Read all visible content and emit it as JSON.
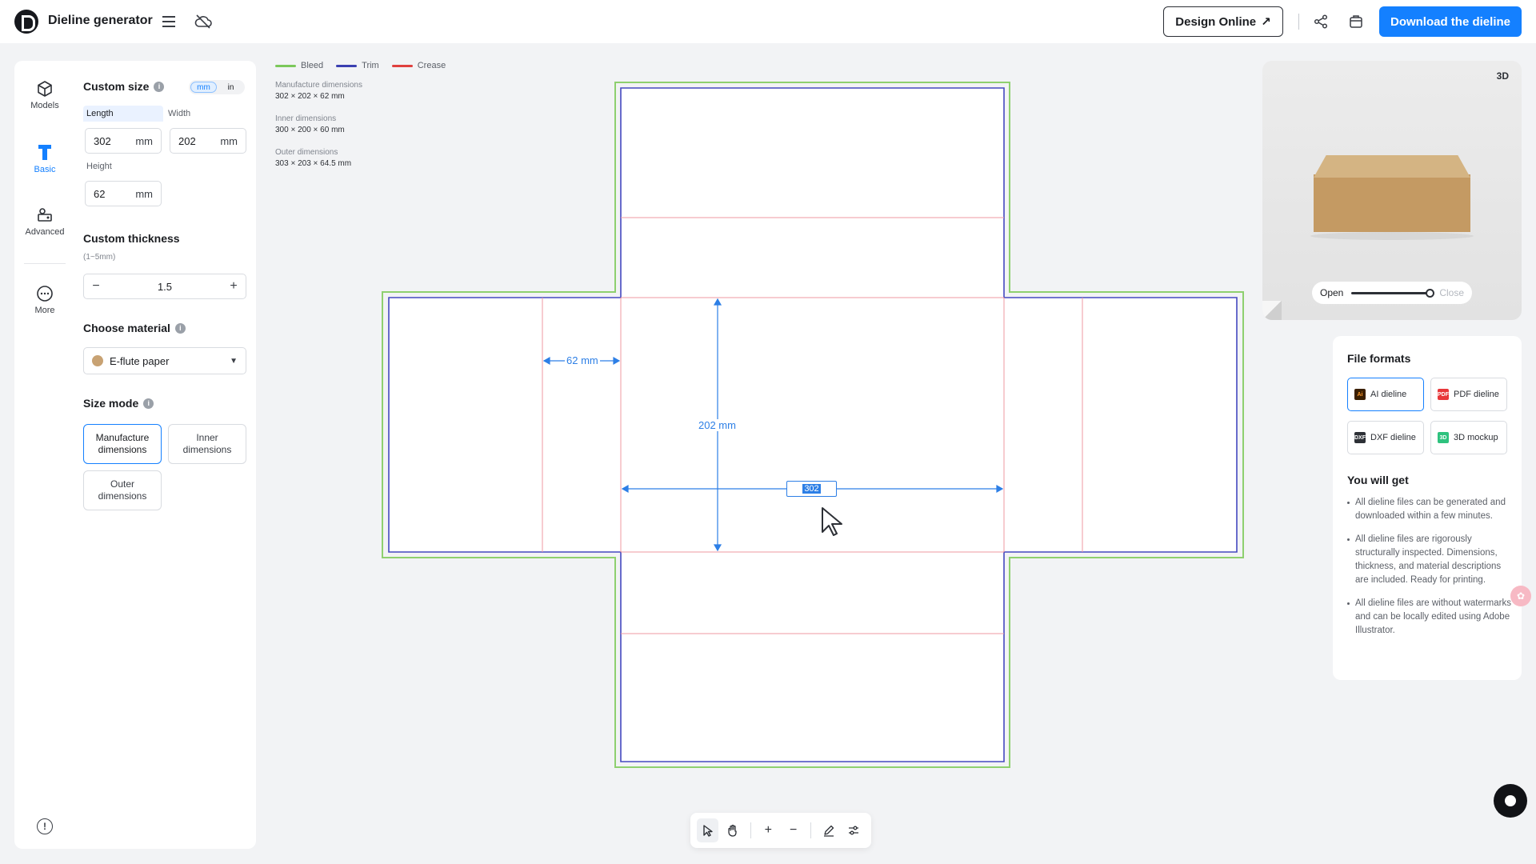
{
  "header": {
    "app_title": "Dieline generator",
    "icons": [
      "menu-icon",
      "cloud-off-icon",
      "share-icon",
      "cart-icon"
    ],
    "design_online_label": "Design Online",
    "download_label": "Download the dieline",
    "accent": "#1480ff"
  },
  "rail": {
    "items": [
      {
        "label": "Models",
        "icon": "cube-icon",
        "active": false
      },
      {
        "label": "Basic",
        "icon": "ruler-icon",
        "active": true
      },
      {
        "label": "Advanced",
        "icon": "shapes-icon",
        "active": false
      },
      {
        "label": "More",
        "icon": "more-icon",
        "active": false
      }
    ]
  },
  "form": {
    "custom_size_title": "Custom size",
    "units": [
      "mm",
      "in"
    ],
    "selected_unit": "mm",
    "length_label": "Length",
    "width_label": "Width",
    "height_label": "Height",
    "length_value": "302",
    "width_value": "202",
    "height_value": "62",
    "unit_suffix": "mm",
    "thickness_title": "Custom thickness",
    "thickness_hint": "(1~5mm)",
    "thickness_value": "1.5",
    "material_title": "Choose material",
    "material_value": "E-flute paper",
    "size_mode_title": "Size mode",
    "size_modes": [
      "Manufacture dimensions",
      "Inner dimensions",
      "Outer dimensions"
    ],
    "selected_size_mode": "Manufacture dimensions"
  },
  "canvas": {
    "legend": [
      {
        "label": "Bleed",
        "color": "#7bc85a"
      },
      {
        "label": "Trim",
        "color": "#3b3fb0"
      },
      {
        "label": "Crease",
        "color": "#e0403e"
      }
    ],
    "dimensions": [
      {
        "label": "Manufacture dimensions",
        "value": "302 × 202 × 62 mm"
      },
      {
        "label": "Inner dimensions",
        "value": "300 × 200 × 60 mm"
      },
      {
        "label": "Outer dimensions",
        "value": "303 × 203 × 64.5 mm"
      }
    ],
    "dim_height_label": "62 mm",
    "dim_width_label": "202 mm",
    "edit_value": "302"
  },
  "toolbar": {
    "tools": [
      "select-tool-icon",
      "hand-tool-icon",
      "zoom-in-icon",
      "zoom-out-icon",
      "edit-icon",
      "settings-sliders-icon"
    ]
  },
  "preview": {
    "tag": "3D",
    "open_label": "Open",
    "close_label": "Close",
    "open_level": 1.0
  },
  "formats": {
    "title": "File formats",
    "items": [
      {
        "label": "AI dieline",
        "icon_text": "Ai",
        "color": "#ff7b00",
        "selected": true
      },
      {
        "label": "PDF dieline",
        "icon_text": "PDF",
        "color": "#e8373a",
        "selected": false
      },
      {
        "label": "DXF dieline",
        "icon_text": "DXF",
        "color": "#2d3036",
        "selected": false
      },
      {
        "label": "3D mockup",
        "icon_text": "3D",
        "color": "#2ec27e",
        "selected": false
      }
    ],
    "you_will_get_title": "You will get",
    "bullets": [
      "All dieline files can be generated and downloaded within a few minutes.",
      "All dieline files are rigorously structurally inspected. Dimensions, thickness, and material descriptions are included. Ready for printing.",
      "All dieline files are without watermarks and can be locally edited using Adobe Illustrator."
    ]
  }
}
